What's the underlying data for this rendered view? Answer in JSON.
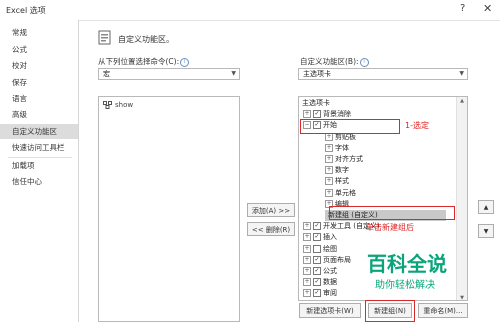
{
  "window": {
    "title": "Excel 选项",
    "help": "?",
    "close": "✕"
  },
  "sidebar": {
    "items": [
      {
        "label": "常规"
      },
      {
        "label": "公式"
      },
      {
        "label": "校对"
      },
      {
        "label": "保存"
      },
      {
        "label": "语言"
      },
      {
        "label": "高级"
      },
      {
        "label": "自定义功能区",
        "active": true
      },
      {
        "label": "快速访问工具栏"
      },
      {
        "label": "加载项"
      },
      {
        "label": "信任中心"
      }
    ]
  },
  "heading": "自定义功能区。",
  "left": {
    "label": "从下列位置选择命令(C):",
    "combo_value": "宏",
    "list_items": [
      {
        "label": "show"
      }
    ]
  },
  "right": {
    "label": "自定义功能区(B):",
    "combo_value": "主选项卡",
    "tree": [
      {
        "label": "主选项卡",
        "level": 0
      },
      {
        "label": "背景消除",
        "level": 1,
        "expander": "+",
        "checked": true
      },
      {
        "label": "开始",
        "level": 1,
        "expander": "−",
        "checked": true
      },
      {
        "label": "剪贴板",
        "level": 2,
        "expander": "+"
      },
      {
        "label": "字体",
        "level": 2,
        "expander": "+"
      },
      {
        "label": "对齐方式",
        "level": 2,
        "expander": "+"
      },
      {
        "label": "数字",
        "level": 2,
        "expander": "+"
      },
      {
        "label": "样式",
        "level": 2,
        "expander": "+"
      },
      {
        "label": "单元格",
        "level": 2,
        "expander": "+"
      },
      {
        "label": "编辑",
        "level": 2,
        "expander": "+"
      },
      {
        "label": "新建组 (自定义)",
        "level": 2,
        "selected": true
      },
      {
        "label": "开发工具 (自定义)",
        "level": 1,
        "expander": "+",
        "checked": true
      },
      {
        "label": "插入",
        "level": 1,
        "expander": "+",
        "checked": true
      },
      {
        "label": "绘图",
        "level": 1,
        "expander": "+",
        "checked": false
      },
      {
        "label": "页面布局",
        "level": 1,
        "expander": "+",
        "checked": true
      },
      {
        "label": "公式",
        "level": 1,
        "expander": "+",
        "checked": true
      },
      {
        "label": "数据",
        "level": 1,
        "expander": "+",
        "checked": true
      },
      {
        "label": "审阅",
        "level": 1,
        "expander": "+",
        "checked": true
      }
    ]
  },
  "buttons": {
    "add": "添加(A) >>",
    "remove": "<< 删除(R)",
    "new_tab": "新建选项卡(W)",
    "new_group": "新建组(N)",
    "rename": "重命名(M)..."
  },
  "annotations": {
    "step1": "1-选定",
    "step2": "单击新建组后"
  },
  "watermark": {
    "title": "百科全说",
    "subtitle": "助你轻松解决"
  },
  "colors": {
    "annotation_red": "#d9292b",
    "watermark_green": "#0aa47a"
  }
}
